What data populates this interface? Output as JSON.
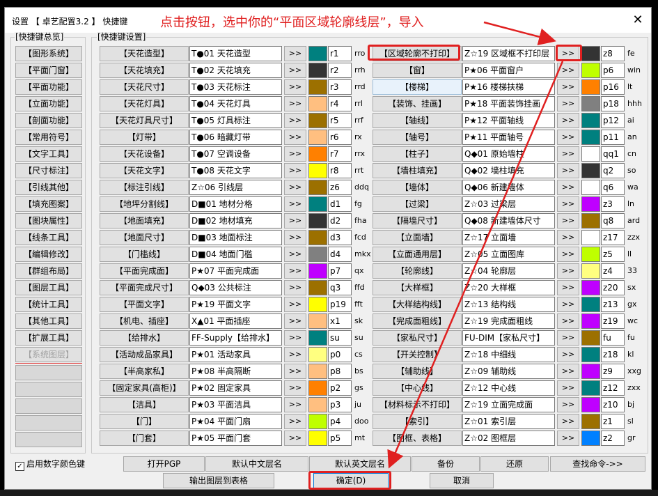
{
  "window": {
    "title": "设置 【 卓艺配置3.2 】 快捷键",
    "close_glyph": "✕"
  },
  "annotation": {
    "text": "点击按钮，选中你的“平面区域轮廓线层”，导入",
    "color": "#e02020"
  },
  "left_panel": {
    "label": "[快捷键总览]",
    "items": [
      "【图形系统】",
      "【平面门窗】",
      "【平面功能】",
      "【立面功能】",
      "【剖面功能】",
      "【常用符号】",
      "【文字工具】",
      "【尺寸标注】",
      "【引线其他】",
      "【填充图案】",
      "【图块属性】",
      "【线条工具】",
      "【编辑修改】",
      "【群组布局】",
      "【图层工具】",
      "【统计工具】",
      "【其他工具】",
      "【扩展工具】",
      "【系统图层】"
    ],
    "empty_slots": 5
  },
  "main_panel": {
    "label": "[快捷键设置]"
  },
  "arrow_label": ">>",
  "rows_left": [
    {
      "name": "【天花造型】",
      "layer": "T●01 天花造型",
      "color": "#00807f",
      "code": "r1",
      "shortcut": "rro"
    },
    {
      "name": "【天花填充】",
      "layer": "T●02 天花填充",
      "color": "#333333",
      "code": "r2",
      "shortcut": "rrh"
    },
    {
      "name": "【天花尺寸】",
      "layer": "T●03 天花标注",
      "color": "#9c7000",
      "code": "r3",
      "shortcut": "rrd"
    },
    {
      "name": "【天花灯具】",
      "layer": "T●04 天花灯具",
      "color": "#ffbf80",
      "code": "r4",
      "shortcut": "rrl"
    },
    {
      "name": "【天花灯具尺寸】",
      "layer": "T●05 灯具标注",
      "color": "#9c7000",
      "code": "r5",
      "shortcut": "rrf"
    },
    {
      "name": "【灯带】",
      "layer": "T●06 暗藏灯带",
      "color": "#ffbf80",
      "code": "r6",
      "shortcut": "rx"
    },
    {
      "name": "【天花设备】",
      "layer": "T●07 空调设备",
      "color": "#ff8000",
      "code": "r7",
      "shortcut": "rrx"
    },
    {
      "name": "【天花文字】",
      "layer": "T●08 天花文字",
      "color": "#ffff00",
      "code": "r8",
      "shortcut": "rrt"
    },
    {
      "name": "【标注引线】",
      "layer": "Z☆06 引线层",
      "color": "#9c7000",
      "code": "z6",
      "shortcut": "ddq"
    },
    {
      "name": "【地坪分割线】",
      "layer": "D■01 地材分格",
      "color": "#00807f",
      "code": "d1",
      "shortcut": "fg"
    },
    {
      "name": "【地面填充】",
      "layer": "D■02 地材填充",
      "color": "#333333",
      "code": "d2",
      "shortcut": "fha"
    },
    {
      "name": "【地面尺寸】",
      "layer": "D■03 地面标注",
      "color": "#9c7000",
      "code": "d3",
      "shortcut": "fcd"
    },
    {
      "name": "【门槛线】",
      "layer": "D■04 地面门槛",
      "color": "#808080",
      "code": "d4",
      "shortcut": "mkx"
    },
    {
      "name": "【平面完成面】",
      "layer": "P★07 平面完成面",
      "color": "#bf00ff",
      "code": "p7",
      "shortcut": "qx"
    },
    {
      "name": "【平面完成尺寸】",
      "layer": "Q◆03 公共标注",
      "color": "#9c7000",
      "code": "q3",
      "shortcut": "ffd"
    },
    {
      "name": "【平面文字】",
      "layer": "P★19 平面文字",
      "color": "#ffff00",
      "code": "p19",
      "shortcut": "fft"
    },
    {
      "name": "【机电、插座】",
      "layer": "X▲01 平面插座",
      "color": "#ffbf80",
      "code": "x1",
      "shortcut": "sk"
    },
    {
      "name": "【给排水】",
      "layer": "FF-Supply【给排水】",
      "color": "#00807f",
      "code": "su",
      "shortcut": "su"
    },
    {
      "name": "【活动成品家具】",
      "layer": "P★01 活动家具",
      "color": "#ffff80",
      "code": "p0",
      "shortcut": "cs"
    },
    {
      "name": "【半高家私】",
      "layer": "P★08 半高隔断",
      "color": "#ffbf80",
      "code": "p8",
      "shortcut": "bs"
    },
    {
      "name": "【固定家具(高柜)】",
      "layer": "P★02 固定家具",
      "color": "#ff8000",
      "code": "p2",
      "shortcut": "gs"
    },
    {
      "name": "【洁具】",
      "layer": "P★03 平面洁具",
      "color": "#ffbf80",
      "code": "p3",
      "shortcut": "ju"
    },
    {
      "name": "【门】",
      "layer": "P★04 平面门扇",
      "color": "#bfff00",
      "code": "p4",
      "shortcut": "doo"
    },
    {
      "name": "【门套】",
      "layer": "P★05 平面门套",
      "color": "#ffff00",
      "code": "p5",
      "shortcut": "mt"
    }
  ],
  "rows_right": [
    {
      "name": "【区域轮廓不打印】",
      "layer": "Z☆19 区域框不打印层",
      "color": "#333333",
      "code": "z8",
      "shortcut": "fe"
    },
    {
      "name": "【窗】",
      "layer": "P★06 平面窗户",
      "color": "#bfff00",
      "code": "p6",
      "shortcut": "win"
    },
    {
      "name": "【楼梯】",
      "layer": "P★16 楼梯扶梯",
      "color": "#ff8000",
      "code": "p16",
      "shortcut": "lt"
    },
    {
      "name": "【装饰、挂画】",
      "layer": "P★18 平面装饰挂画",
      "color": "#808080",
      "code": "p18",
      "shortcut": "hhh"
    },
    {
      "name": "【轴线】",
      "layer": "P★12 平面轴线",
      "color": "#00807f",
      "code": "p12",
      "shortcut": "ai"
    },
    {
      "name": "【轴号】",
      "layer": "P★11 平面轴号",
      "color": "#00807f",
      "code": "p11",
      "shortcut": "an"
    },
    {
      "name": "【柱子】",
      "layer": "Q◆01 原始墙柱",
      "color": "#ffffff",
      "code": "qq1",
      "shortcut": "cn"
    },
    {
      "name": "【墙柱填充】",
      "layer": "Q◆02 墙柱填充",
      "color": "#333333",
      "code": "q2",
      "shortcut": "so"
    },
    {
      "name": "【墙体】",
      "layer": "Q◆06 新建墙体",
      "color": "#ffffff",
      "code": "q6",
      "shortcut": "wa"
    },
    {
      "name": "【过梁】",
      "layer": "Z☆03 过梁层",
      "color": "#bf00ff",
      "code": "z3",
      "shortcut": "ln"
    },
    {
      "name": "【隔墙尺寸】",
      "layer": "Q◆08 新建墙体尺寸",
      "color": "#9c7000",
      "code": "q8",
      "shortcut": "ard"
    },
    {
      "name": "【立面墙】",
      "layer": "Z☆17 立面墙",
      "color": "#ffffff",
      "code": "z17",
      "shortcut": "zzx"
    },
    {
      "name": "【立面通用层】",
      "layer": "Z☆05 立面图库",
      "color": "#bfff00",
      "code": "z5",
      "shortcut": "ll"
    },
    {
      "name": "【轮廓线】",
      "layer": "Z☆04 轮廓层",
      "color": "#ffff80",
      "code": "z4",
      "shortcut": "33"
    },
    {
      "name": "【大样框】",
      "layer": "Z☆20 大样框",
      "color": "#bf00ff",
      "code": "z20",
      "shortcut": "sx"
    },
    {
      "name": "【大样结构线】",
      "layer": "Z☆13 结构线",
      "color": "#00807f",
      "code": "z13",
      "shortcut": "gx"
    },
    {
      "name": "【完成面粗线】",
      "layer": "Z☆19 完成面粗线",
      "color": "#bf00ff",
      "code": "z19",
      "shortcut": "wc"
    },
    {
      "name": "【家私尺寸】",
      "layer": "FU-DIM【家私尺寸】",
      "color": "#9c7000",
      "code": "fu",
      "shortcut": "fu"
    },
    {
      "name": "【开关控制】",
      "layer": "Z☆18 中细线",
      "color": "#00807f",
      "code": "z18",
      "shortcut": "kl"
    },
    {
      "name": "【辅助线】",
      "layer": "Z☆09 辅助线",
      "color": "#bf00ff",
      "code": "z9",
      "shortcut": "xxg"
    },
    {
      "name": "【中心线】",
      "layer": "Z☆12 中心线",
      "color": "#00807f",
      "code": "z12",
      "shortcut": "zxx"
    },
    {
      "name": "【材料标示不打印】",
      "layer": "Z☆19 立面完成面",
      "color": "#bf00ff",
      "code": "z10",
      "shortcut": "bj"
    },
    {
      "name": "【索引】",
      "layer": "Z☆01 索引层",
      "color": "#9c7000",
      "code": "z1",
      "shortcut": "sl"
    },
    {
      "name": "【图框、表格】",
      "layer": "Z☆02 图框层",
      "color": "#0080ff",
      "code": "z2",
      "shortcut": "gr"
    }
  ],
  "checkbox": {
    "label": "启用数字颜色键",
    "checked_glyph": "✓"
  },
  "buttons": {
    "open_pgp": "打开PGP",
    "default_cn": "默认中文层名",
    "default_en": "默认英文层名",
    "backup": "备份",
    "restore": "还原",
    "find_cmd": "查找命令->>",
    "export": "输出图层到表格",
    "ok": "确定(D)",
    "cancel": "取消"
  }
}
